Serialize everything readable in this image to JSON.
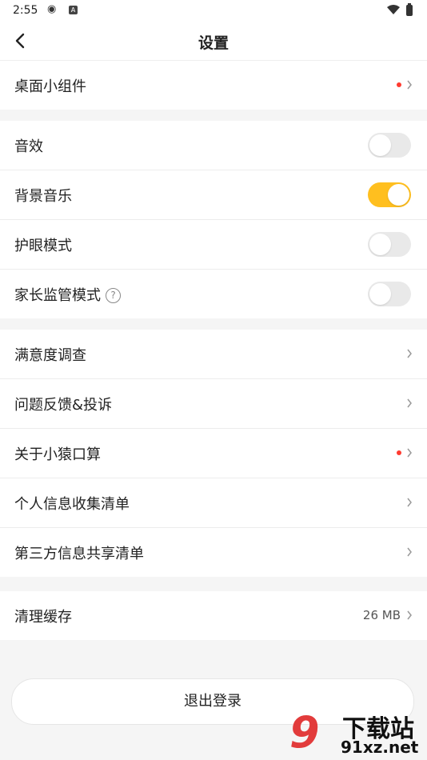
{
  "status_bar": {
    "time": "2:55"
  },
  "header": {
    "title": "设置"
  },
  "groups": {
    "widget": {
      "label": "桌面小组件"
    },
    "toggles": [
      {
        "label": "音效",
        "on": false
      },
      {
        "label": "背景音乐",
        "on": true
      },
      {
        "label": "护眼模式",
        "on": false
      },
      {
        "label": "家长监管模式",
        "on": false
      }
    ],
    "links": [
      {
        "label": "满意度调查"
      },
      {
        "label": "问题反馈&投诉"
      },
      {
        "label": "关于小猿口算"
      },
      {
        "label": "个人信息收集清单"
      },
      {
        "label": "第三方信息共享清单"
      }
    ],
    "cache": {
      "label": "清理缓存",
      "value": "26 MB"
    }
  },
  "logout": {
    "label": "退出登录"
  },
  "watermark": {
    "cn": "下载站",
    "url": "91xz.net"
  },
  "colors": {
    "toggle_on": "#ffbf1f",
    "badge_dot": "#ff3b30"
  }
}
